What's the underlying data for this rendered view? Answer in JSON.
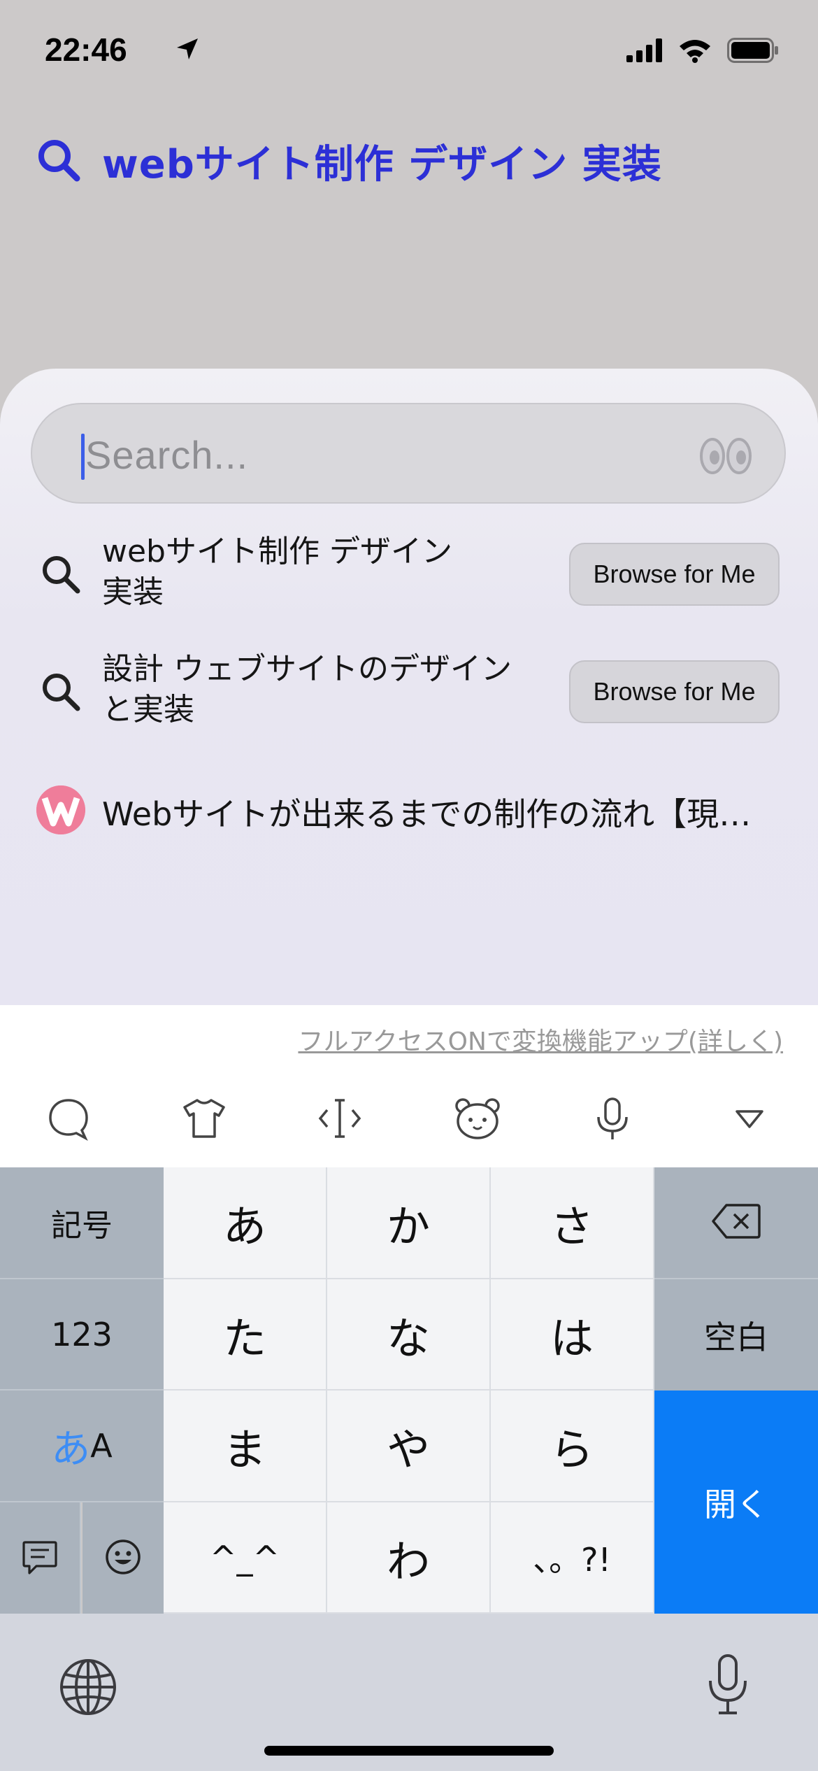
{
  "status_bar": {
    "time": "22:46"
  },
  "query": {
    "text": "webサイト制作 デザイン 実装"
  },
  "search": {
    "placeholder": "Search..."
  },
  "suggestions": [
    {
      "line1": "webサイト制作 デザイン",
      "line2": "実装",
      "button": "Browse for Me"
    },
    {
      "line1": "設計 ウェブサイトのデザイン",
      "line2": "と実装",
      "button": "Browse for Me"
    }
  ],
  "site_result": {
    "title": "Webサイトが出来るまでの制作の流れ【現…"
  },
  "keyboard": {
    "full_access_label": "フルアクセスONで変換機能アップ(詳しく)",
    "keys": {
      "kigou": "記号",
      "num": "123",
      "kana_a": "あ",
      "latin_a": "A",
      "a": "あ",
      "ka": "か",
      "sa": "さ",
      "ta": "た",
      "na": "な",
      "ha": "は",
      "ma": "ま",
      "ya": "や",
      "ra": "ら",
      "kaomoji": "^_^",
      "wa": "わ",
      "punct": "、。?!",
      "space": "空白",
      "enter": "開く"
    },
    "colors": {
      "enter": "#0b7cf6",
      "kana_highlight": "#3d8df5"
    }
  }
}
